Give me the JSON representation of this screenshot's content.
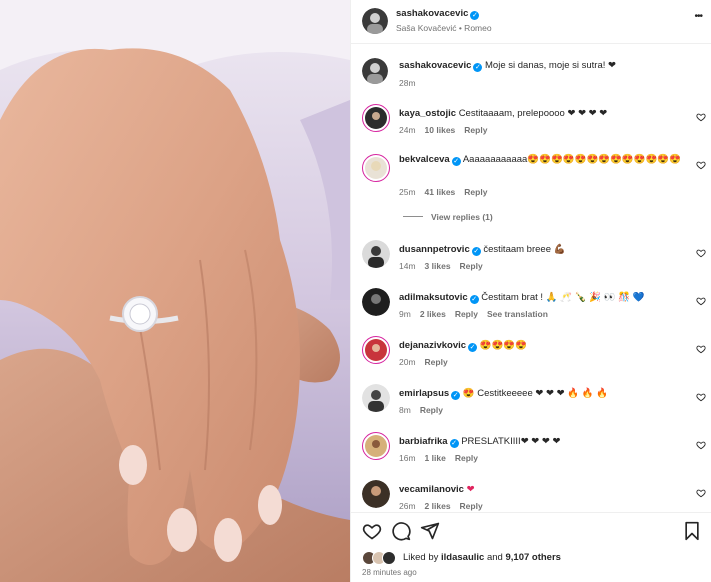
{
  "photo": {
    "alt_subject": "hand with engagement ring"
  },
  "header": {
    "username": "sashakovacevic",
    "subtitle": "Saša Kovačević • Romeo",
    "more_label": "•••"
  },
  "caption": {
    "username": "sashakovacevic",
    "text": "Moje si danas, moje si sutra! ❤",
    "time": "28m"
  },
  "comments": [
    {
      "username": "kaya_ostojic",
      "verified": false,
      "text": "Cestitaaaam, prelepoooo ❤ ❤ ❤ ❤",
      "time": "24m",
      "likes": "10 likes",
      "reply": "Reply"
    },
    {
      "username": "bekvalceva",
      "verified": true,
      "text": "Aaaaaaaaaaaa😍😍😍😍😍😍😍😍😍😍😍😍😍",
      "time": "25m",
      "likes": "41 likes",
      "reply": "Reply",
      "view_replies": "View replies (1)"
    },
    {
      "username": "dusannpetrovic",
      "verified": true,
      "text": "čestitaam breee 💪🏾",
      "time": "14m",
      "likes": "3 likes",
      "reply": "Reply"
    },
    {
      "username": "adilmaksutovic",
      "verified": true,
      "text": "Čestitam brat ! 🙏 🥂 🍾 🎉 👀 🎊 💙",
      "time": "9m",
      "likes": "2 likes",
      "reply": "Reply",
      "translate": "See translation"
    },
    {
      "username": "dejanazivkovic",
      "verified": true,
      "text": "😍😍😍😍",
      "time": "20m",
      "likes": "",
      "reply": "Reply"
    },
    {
      "username": "emirlapsus",
      "verified": true,
      "text": "😍 Cestitkeeeee ❤ ❤ ❤ 🔥 🔥 🔥",
      "time": "8m",
      "likes": "",
      "reply": "Reply"
    },
    {
      "username": "barbiafrika",
      "verified": true,
      "text": "PRESLATKIIII❤ ❤ ❤ ❤",
      "time": "16m",
      "likes": "1 like",
      "reply": "Reply"
    },
    {
      "username": "vecamilanovic",
      "verified": false,
      "text": "❤",
      "time": "26m",
      "likes": "2 likes",
      "reply": "Reply"
    }
  ],
  "footer": {
    "liked_by_prefix": "Liked by ",
    "liked_by_user": "ildasaulic",
    "liked_by_mid": " and ",
    "liked_by_count": "9,107 others",
    "timestamp": "28 minutes ago"
  },
  "colors": {
    "accent": "#0095f6",
    "heart": "#ed4956",
    "text": "#262626",
    "muted": "#737373"
  }
}
